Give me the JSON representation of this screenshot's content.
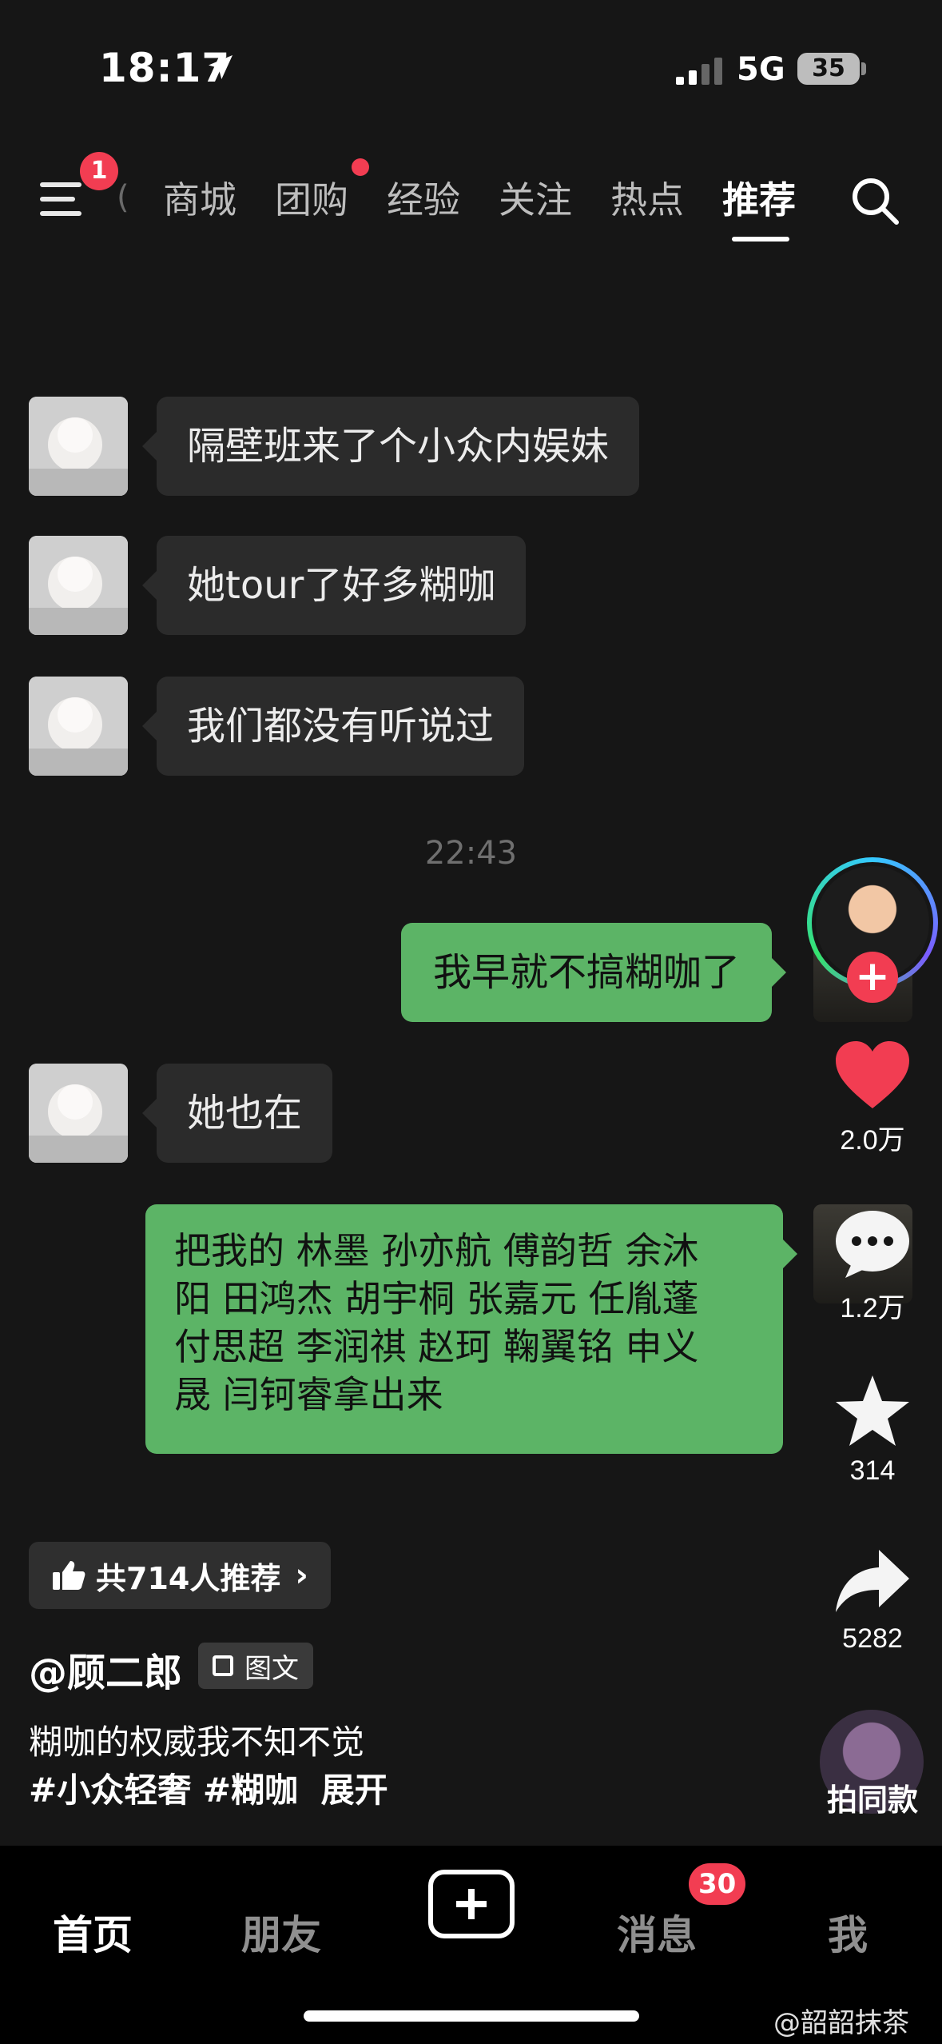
{
  "status_bar": {
    "time": "18:17",
    "network": "5G",
    "battery": "35"
  },
  "top_nav": {
    "menu_badge": "1",
    "cut_tab": "(",
    "tabs": [
      {
        "label": "商城"
      },
      {
        "label": "团购"
      },
      {
        "label": "经验"
      },
      {
        "label": "关注"
      },
      {
        "label": "热点"
      },
      {
        "label": "推荐"
      }
    ],
    "active_tab": "推荐"
  },
  "chat": {
    "messages": [
      {
        "side": "in",
        "text": "隔壁班来了个小众内娱妹"
      },
      {
        "side": "in",
        "text": "她tour了好多糊咖"
      },
      {
        "side": "in",
        "text": "我们都没有听说过"
      },
      {
        "side": "out",
        "text": "我早就不搞糊咖了"
      },
      {
        "side": "in",
        "text": "她也在"
      },
      {
        "side": "out",
        "lines": [
          "把我的 林墨 孙亦航 傅韵哲 余沐",
          "阳 田鸿杰 胡宇桐 张嘉元 任胤蓬",
          "付思超 李润祺 赵珂 鞠翼铭 申义",
          "晟 闫钶睿拿出来"
        ]
      }
    ],
    "timestamp": "22:43"
  },
  "rail": {
    "likes": "2.0万",
    "comments": "1.2万",
    "favorites": "314",
    "shares": "5282",
    "same_style": "拍同款",
    "follow": "+"
  },
  "post": {
    "recommend": "共714人推荐",
    "author": "@顾二郎",
    "type_badge": "图文",
    "description": "糊咖的权威我不知不觉",
    "tags": "#小众轻奢 #糊咖",
    "expand": "展开"
  },
  "bottom_nav": {
    "tabs": [
      "首页",
      "朋友",
      "消息",
      "我"
    ],
    "message_badge": "30"
  },
  "watermark": "@韶韶抹茶",
  "colors": {
    "accent": "#f23d52",
    "bubble_out": "#5cb466",
    "bubble_in": "#2b2b2b",
    "background": "#161616"
  }
}
